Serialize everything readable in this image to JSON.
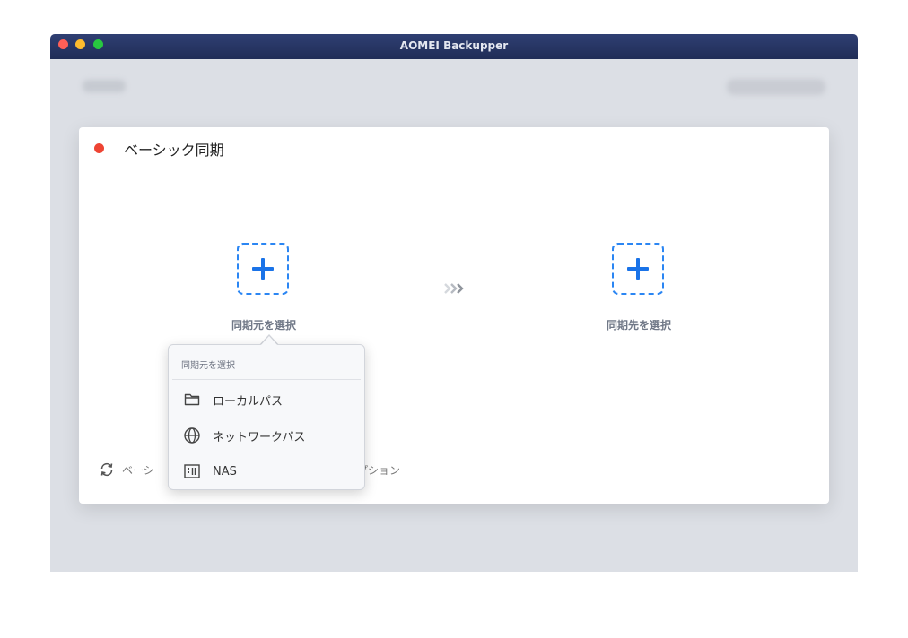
{
  "window": {
    "title": "AOMEI Backupper"
  },
  "card": {
    "title": "ベーシック同期"
  },
  "source": {
    "label": "同期元を選択"
  },
  "destination": {
    "label": "同期先を選択"
  },
  "bottom": {
    "sync_label": "ベーシ",
    "options_label": "プション"
  },
  "popover": {
    "header": "同期元を選択",
    "items": [
      {
        "label": "ローカルパス",
        "icon": "folder-icon"
      },
      {
        "label": "ネットワークパス",
        "icon": "globe-icon"
      },
      {
        "label": "NAS",
        "icon": "nas-icon"
      }
    ]
  },
  "colors": {
    "titlebar": "#27356a",
    "accent": "#1a73e8",
    "status_dot": "#ee4433",
    "window_bg": "#dcdfe5"
  }
}
